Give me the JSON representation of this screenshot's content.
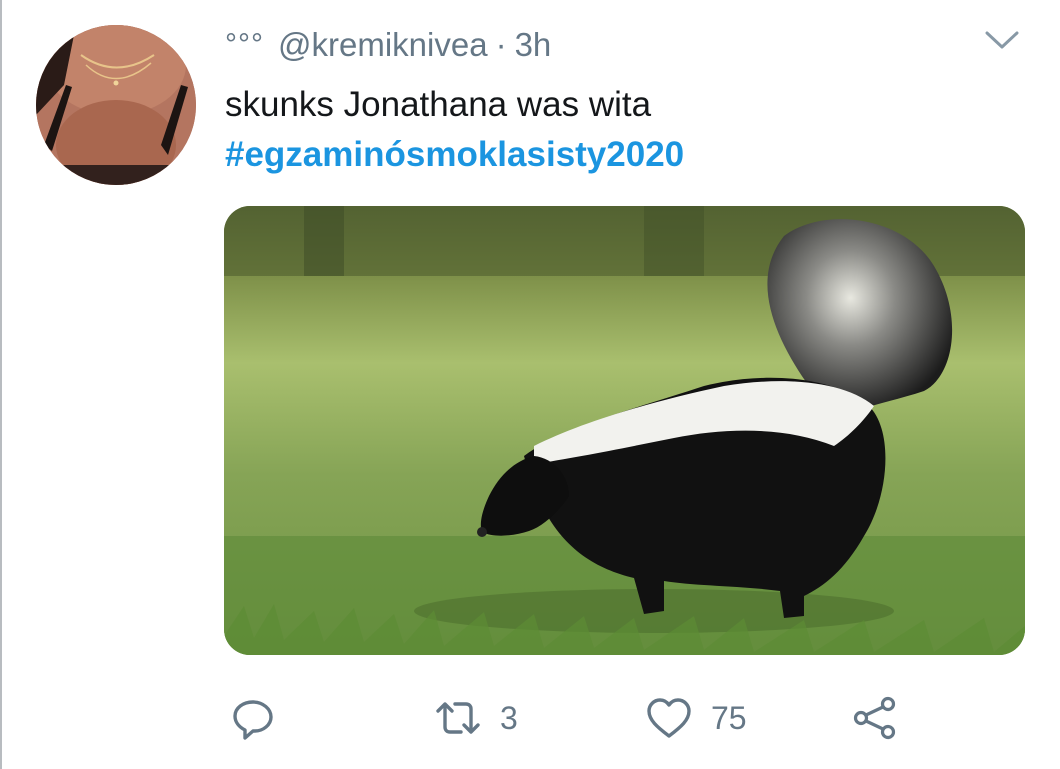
{
  "tweet": {
    "display_name": "°°°",
    "handle": "@kremiknivea",
    "separator": "·",
    "time": "3h",
    "text": "skunks Jonathana was wita",
    "hashtag": "#egzaminósmoklasisty2020",
    "media_alt": "skunk on grass"
  },
  "actions": {
    "reply_icon": "reply-icon",
    "retweet_icon": "retweet-icon",
    "retweet_count": "3",
    "like_icon": "heart-icon",
    "like_count": "75",
    "share_icon": "share-icon"
  },
  "colors": {
    "text": "#14171a",
    "secondary": "#657786",
    "hashtag": "#1b95e0"
  }
}
